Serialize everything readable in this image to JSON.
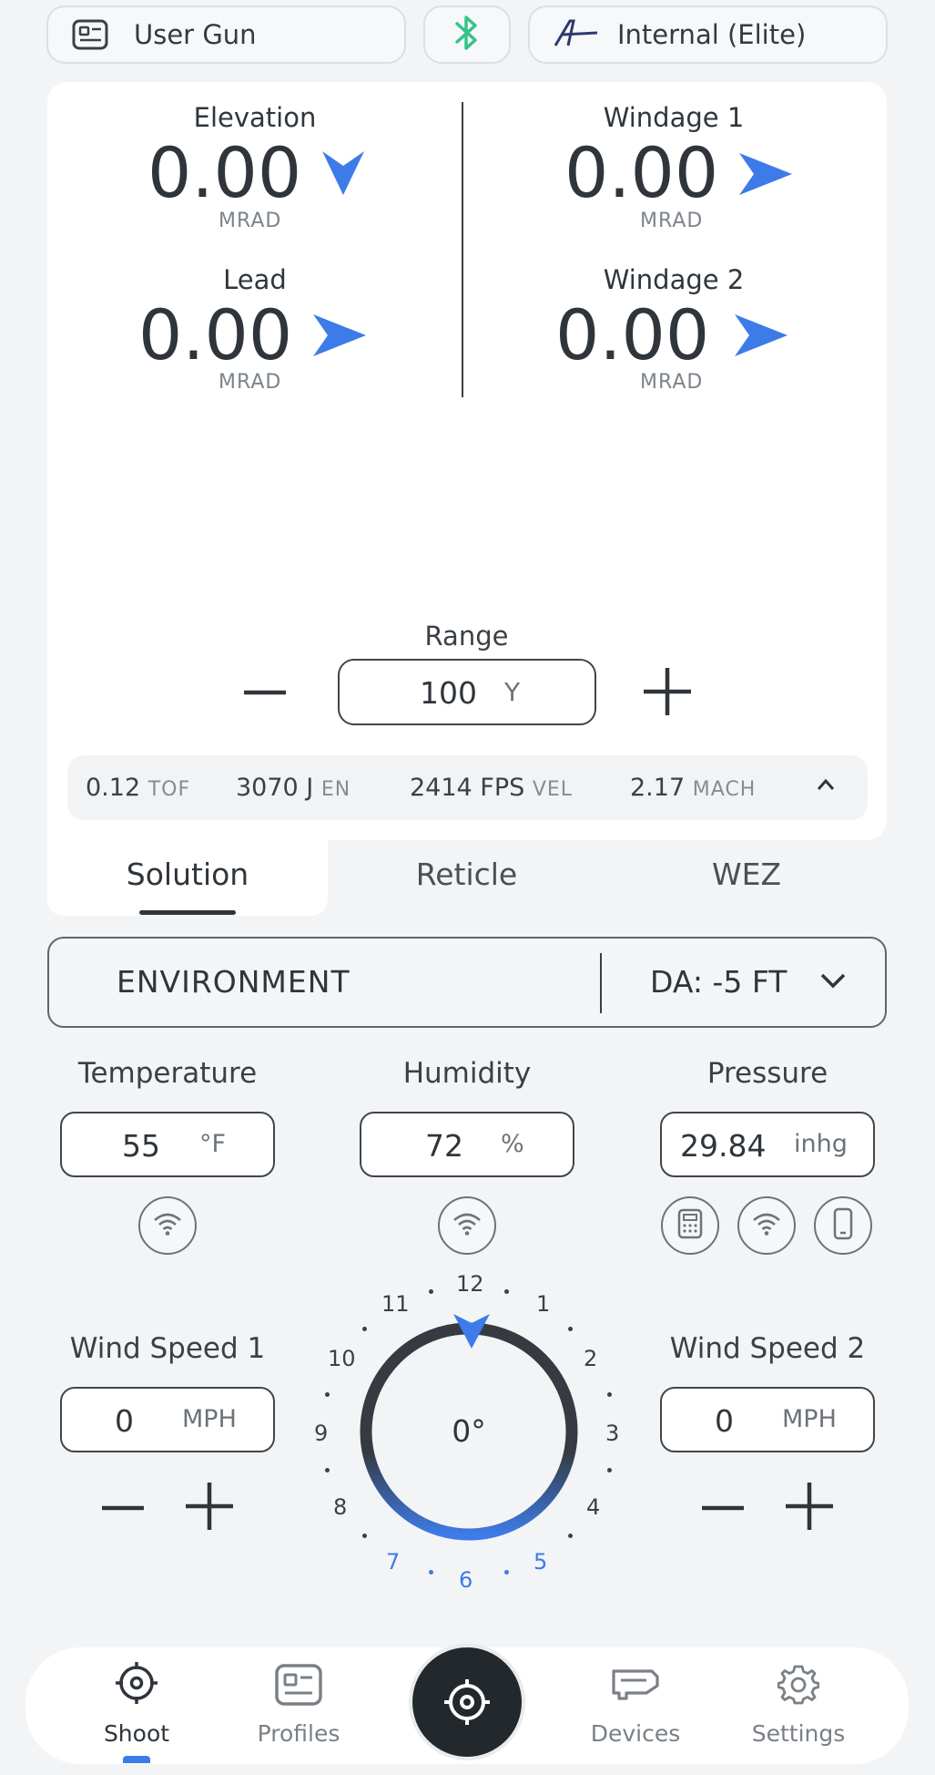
{
  "header": {
    "profile_label": "User Gun",
    "device_label": "Internal (Elite)"
  },
  "solution": {
    "elevation": {
      "label": "Elevation",
      "value": "0.00",
      "unit": "MRAD"
    },
    "windage1": {
      "label": "Windage 1",
      "value": "0.00",
      "unit": "MRAD"
    },
    "lead": {
      "label": "Lead",
      "value": "0.00",
      "unit": "MRAD"
    },
    "windage2": {
      "label": "Windage 2",
      "value": "0.00",
      "unit": "MRAD"
    }
  },
  "range": {
    "label": "Range",
    "value": "100",
    "unit": "Y"
  },
  "stats": [
    {
      "value": "0.12",
      "suffix": "TOF"
    },
    {
      "value": "3070 J",
      "suffix": "EN"
    },
    {
      "value": "2414 FPS",
      "suffix": "VEL"
    },
    {
      "value": "2.17",
      "suffix": "MACH"
    }
  ],
  "tabs": [
    "Solution",
    "Reticle",
    "WEZ"
  ],
  "environment": {
    "title": "ENVIRONMENT",
    "da": "DA: -5 FT"
  },
  "conditions": {
    "temperature": {
      "label": "Temperature",
      "value": "55",
      "unit": "°F"
    },
    "humidity": {
      "label": "Humidity",
      "value": "72",
      "unit": "%"
    },
    "pressure": {
      "label": "Pressure",
      "value": "29.84",
      "unit": "inhg"
    }
  },
  "wind": {
    "speed1": {
      "label": "Wind Speed 1",
      "value": "0",
      "unit": "MPH"
    },
    "speed2": {
      "label": "Wind Speed 2",
      "value": "0",
      "unit": "MPH"
    },
    "direction": "0°",
    "clock": [
      "12",
      "1",
      "2",
      "3",
      "4",
      "5",
      "6",
      "7",
      "8",
      "9",
      "10",
      "11"
    ]
  },
  "nav": {
    "shoot": "Shoot",
    "profiles": "Profiles",
    "devices": "Devices",
    "settings": "Settings"
  },
  "colors": {
    "accent": "#3d7be8",
    "bluetooth": "#37c28a",
    "text": "#333a40"
  }
}
